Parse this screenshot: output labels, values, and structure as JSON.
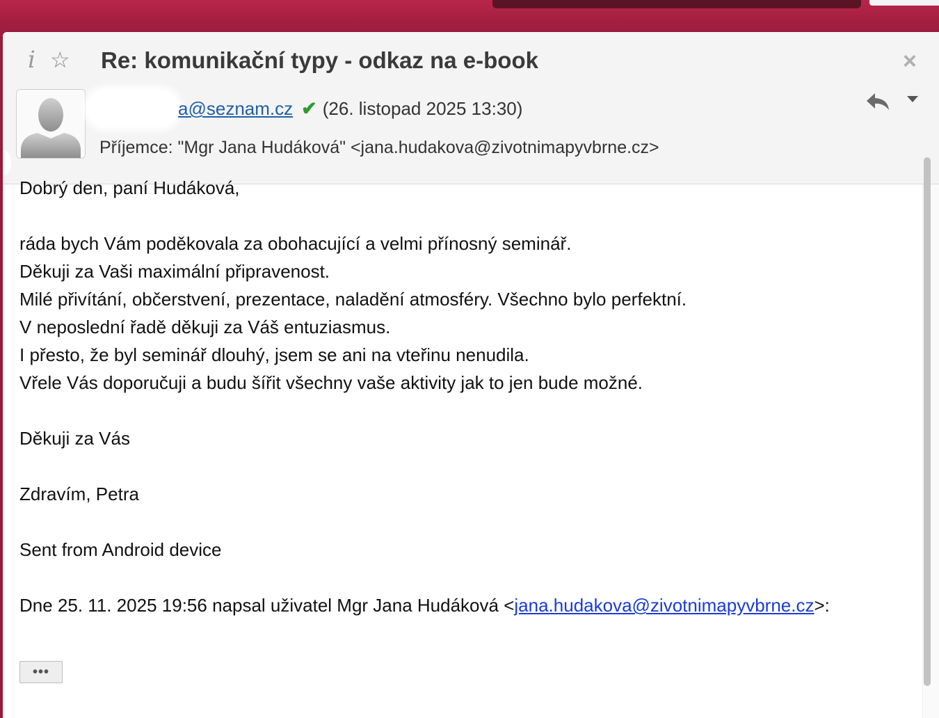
{
  "colors": {
    "background": "#a31f40",
    "link": "#1f5fa6",
    "quote_link": "#1a3bd6",
    "verified": "#2e9b2e"
  },
  "header": {
    "info_icon": "i",
    "star_icon": "☆",
    "subject": "Re: komunikační typy - odkaz na e-book",
    "close_icon": "×",
    "sender_email_visible": "a@seznam.cz",
    "verified_icon": "✔",
    "date": "(26. listopad 2025 13:30)",
    "recipient": "Příjemce: \"Mgr Jana Hudáková\" <jana.hudakova@zivotnimapyvbrne.cz>"
  },
  "icons": {
    "info": "info-icon",
    "star": "star-icon",
    "close": "close-icon",
    "avatar": "avatar-placeholder",
    "verified": "checkmark-icon",
    "reply": "reply-icon",
    "more_actions": "chevron-down-icon"
  },
  "body": {
    "greeting": "Dobrý den, paní Hudáková,",
    "line1": "ráda bych Vám poděkovala za obohacující a velmi přínosný seminář.",
    "line2": "Děkuji za Vaši maximální připravenost.",
    "line3": "Milé přivítání, občerstvení, prezentace, naladění atmosféry. Všechno bylo perfektní.",
    "line4": "V neposlední řadě děkuji za Váš entuziasmus.",
    "line5": "I přesto, že byl seminář dlouhý, jsem se ani na vteřinu nenudila.",
    "line6": "Vřele Vás doporučuji a budu šířit všechny vaše aktivity jak to jen bude možné.",
    "thanks": "Děkuji za Vás",
    "signature": "Zdravím, Petra",
    "device": "Sent from Android device",
    "quote_prefix": "Dne 25. 11. 2025 19:56 napsal uživatel Mgr Jana Hudáková <",
    "quote_email": "jana.hudakova@zivotnimapyvbrne.cz",
    "quote_suffix": ">:",
    "show_more_label": "•••"
  }
}
